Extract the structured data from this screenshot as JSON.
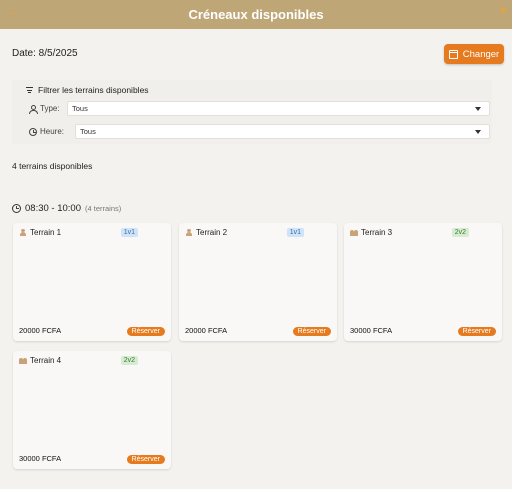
{
  "appbar": {
    "title": "Créneaux disponibles",
    "back_glyph": "←",
    "filter_glyph": "▼"
  },
  "date": {
    "label": "Date: 8/5/2025"
  },
  "change_button": {
    "label": "Changer"
  },
  "filters": {
    "title": "Filtrer les terrains disponibles",
    "type_label": "Type:",
    "type_value": "Tous",
    "time_label": "Heure:",
    "time_value": "Tous"
  },
  "available_count": "4 terrains disponibles",
  "slot": {
    "time": "08:30 - 10:00",
    "count": "(4 terrains)"
  },
  "reserve_label": "Réserver",
  "terrains": [
    {
      "name": "Terrain 1",
      "format": "1v1",
      "price": "20000 FCFA"
    },
    {
      "name": "Terrain 2",
      "format": "1v1",
      "price": "20000 FCFA"
    },
    {
      "name": "Terrain 3",
      "format": "2v2",
      "price": "30000 FCFA"
    },
    {
      "name": "Terrain 4",
      "format": "2v2",
      "price": "30000 FCFA"
    }
  ]
}
